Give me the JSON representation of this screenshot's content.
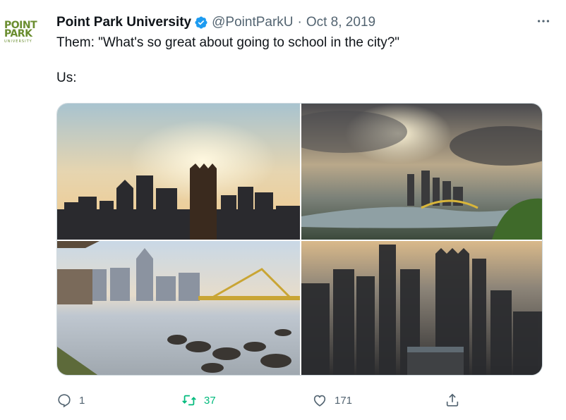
{
  "account": {
    "name": "Point Park University",
    "handle": "@PointParkU",
    "separator": "·",
    "date": "Oct 8, 2019",
    "avatar_logo": [
      "POINT",
      "PARK",
      "UNIVERSITY"
    ],
    "verified_icon": "verified-badge-icon"
  },
  "tweet": {
    "lines": [
      "Them: \"What's so great about going to school in the city?\"",
      "Us:"
    ]
  },
  "media": {
    "images": [
      "pittsburgh-skyline-sunrise-photo",
      "pittsburgh-aerial-clouds-photo",
      "pittsburgh-river-bridge-reflection-photo",
      "pittsburgh-downtown-aerial-haze-photo"
    ]
  },
  "actions": {
    "reply_count": "1",
    "retweet_count": "37",
    "like_count": "171"
  },
  "colors": {
    "text": "#0f1419",
    "secondary": "#536471",
    "verified": "#1d9bf0",
    "retweet": "#00ba7c",
    "logo": "#6a8d2f"
  }
}
